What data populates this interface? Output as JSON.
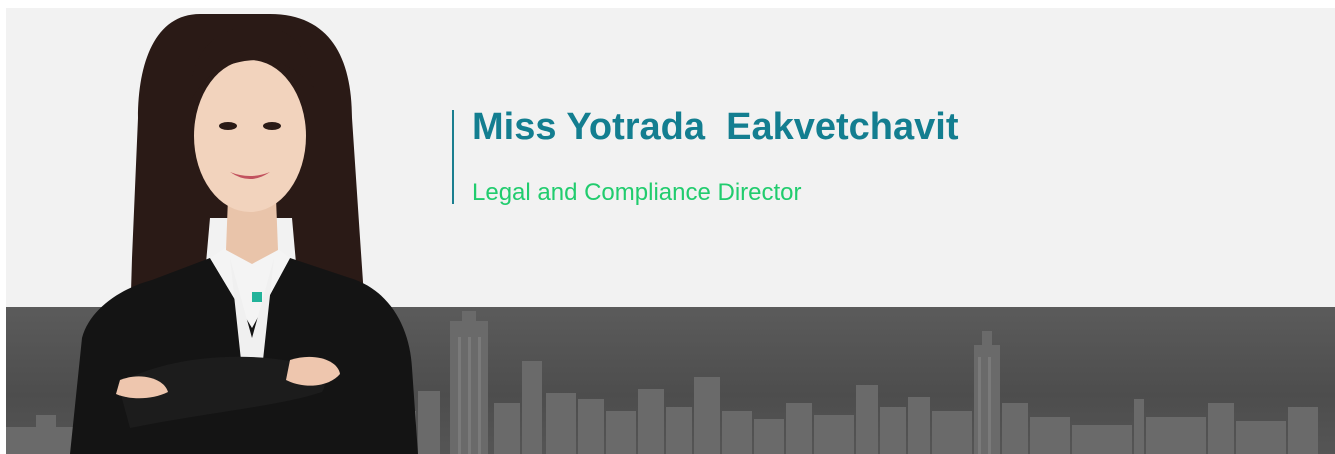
{
  "profile": {
    "name": "Miss Yotrada  Eakvetchavit",
    "title": "Legal and Compliance Director"
  },
  "colors": {
    "name": "#137e90",
    "title": "#21cc6e",
    "banner_light": "#f2f2f2",
    "banner_dark": "#555555"
  },
  "images": {
    "portrait": "portrait-photo",
    "skyline": "city-skyline"
  }
}
